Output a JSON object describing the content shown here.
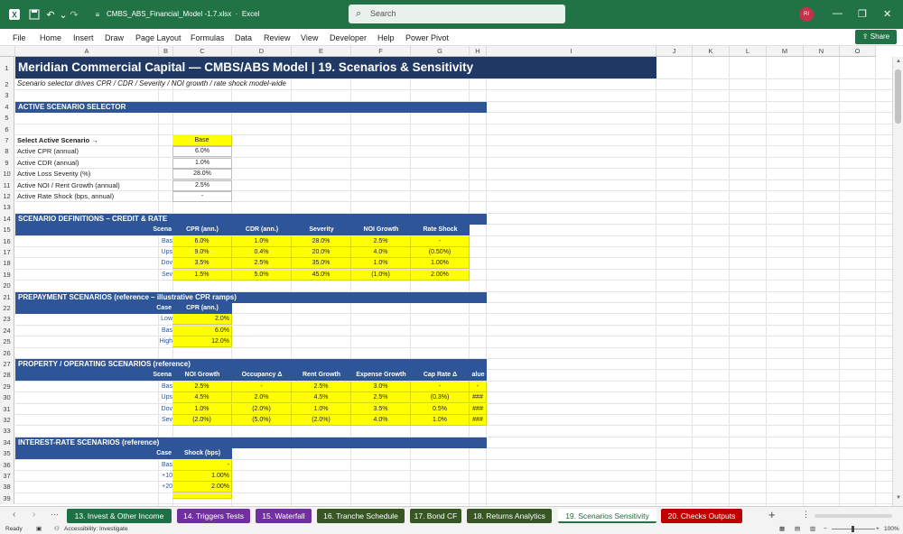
{
  "app": {
    "file_name": "CMBS_ABS_Financial_Model -1.7.xlsx",
    "app_name": "Excel",
    "search_placeholder": "Search",
    "user_initials": "RI",
    "share_label": "Share"
  },
  "menu": [
    "File",
    "Home",
    "Insert",
    "Draw",
    "Page Layout",
    "Formulas",
    "Data",
    "Review",
    "View",
    "Developer",
    "Help",
    "Power Pivot"
  ],
  "columns": [
    "A",
    "B",
    "C",
    "D",
    "E",
    "F",
    "G",
    "H",
    "I",
    "J",
    "K",
    "L",
    "M",
    "N",
    "O"
  ],
  "rows": [
    "1",
    "2",
    "3",
    "4",
    "5",
    "6",
    "7",
    "8",
    "9",
    "10",
    "11",
    "12",
    "13",
    "14",
    "15",
    "16",
    "17",
    "18",
    "19",
    "20",
    "21",
    "22",
    "23",
    "24",
    "25",
    "26",
    "27",
    "28",
    "29",
    "30",
    "31",
    "32",
    "33",
    "34",
    "35",
    "36",
    "37",
    "38",
    "39"
  ],
  "sheet": {
    "title": "Meridian Commercial Capital — CMBS/ABS Model  |  19. Scenarios & Sensitivity",
    "subtitle": "Scenario selector drives CPR / CDR / Severity / NOI growth / rate shock model-wide",
    "selector": {
      "header": "ACTIVE SCENARIO SELECTOR",
      "rows": [
        {
          "label": "Select Active Scenario →",
          "value": "Base",
          "bold": true,
          "yellow": true
        },
        {
          "label": "Active CPR (annual)",
          "value": "6.0%"
        },
        {
          "label": "Active CDR (annual)",
          "value": "1.0%"
        },
        {
          "label": "Active Loss Severity (%)",
          "value": "28.0%"
        },
        {
          "label": "Active NOI / Rent Growth (annual)",
          "value": "2.5%"
        },
        {
          "label": "Active Rate Shock (bps, annual)",
          "value": "-"
        }
      ]
    },
    "definitions": {
      "header": "SCENARIO DEFINITIONS – CREDIT & RATE",
      "col_label": "Scena",
      "columns": [
        "CPR (ann.)",
        "CDR (ann.)",
        "Severity",
        "NOI Growth",
        "Rate Shock"
      ],
      "rows": [
        {
          "label": "Bas",
          "values": [
            "6.0%",
            "1.0%",
            "28.0%",
            "2.5%",
            "-"
          ]
        },
        {
          "label": "Ups",
          "values": [
            "9.0%",
            "0.4%",
            "20.0%",
            "4.0%",
            "(0.50%)"
          ]
        },
        {
          "label": "Dov",
          "values": [
            "3.5%",
            "2.5%",
            "35.0%",
            "1.0%",
            "1.00%"
          ]
        },
        {
          "label": "Sev",
          "values": [
            "1.5%",
            "5.0%",
            "45.0%",
            "(1.0%)",
            "2.00%"
          ]
        }
      ]
    },
    "prepayment": {
      "header": "PREPAYMENT SCENARIOS (reference – illustrative CPR ramps)",
      "col_label": "Case",
      "column": "CPR (ann.)",
      "rows": [
        {
          "label": "Low",
          "value": "2.0%"
        },
        {
          "label": "Bas",
          "value": "6.0%"
        },
        {
          "label": "High",
          "value": "12.0%"
        }
      ]
    },
    "property": {
      "header": "PROPERTY / OPERATING SCENARIOS (reference)",
      "col_label": "Scena",
      "columns": [
        "NOI Growth",
        "Occupancy Δ",
        "Rent Growth",
        "Expense Growth",
        "Cap Rate Δ",
        "alue"
      ],
      "rows": [
        {
          "label": "Bas",
          "values": [
            "2.5%",
            "-",
            "2.5%",
            "3.0%",
            "-",
            "-"
          ]
        },
        {
          "label": "Ups",
          "values": [
            "4.5%",
            "2.0%",
            "4.5%",
            "2.5%",
            "(0.3%)",
            "###"
          ]
        },
        {
          "label": "Dov",
          "values": [
            "1.0%",
            "(2.0%)",
            "1.0%",
            "3.5%",
            "0.5%",
            "###"
          ]
        },
        {
          "label": "Sev",
          "values": [
            "(2.0%)",
            "(5.0%)",
            "(2.0%)",
            "4.0%",
            "1.0%",
            "###"
          ]
        }
      ]
    },
    "interest": {
      "header": "INTEREST-RATE SCENARIOS (reference)",
      "col_label": "Case",
      "column": "Shock (bps)",
      "rows": [
        {
          "label": "Bas",
          "value": "-"
        },
        {
          "label": "+10",
          "value": "1.00%"
        },
        {
          "label": "+20",
          "value": "2.00%"
        }
      ]
    }
  },
  "tabs": [
    {
      "label": "13. Invest & Other Income",
      "color": "#1e7145"
    },
    {
      "label": "14. Triggers Tests",
      "color": "#7030a0"
    },
    {
      "label": "15. Waterfall",
      "color": "#7030a0"
    },
    {
      "label": "16. Tranche Schedule",
      "color": "#375623"
    },
    {
      "label": "17. Bond CF",
      "color": "#375623"
    },
    {
      "label": "18. Returns Analytics",
      "color": "#375623"
    },
    {
      "label": "19. Scenarios Sensitivity",
      "color": "#ffffff",
      "active": true
    },
    {
      "label": "20. Checks Outputs",
      "color": "#c00000"
    }
  ],
  "status": {
    "ready": "Ready",
    "accessibility": "Accessibility: Investigate",
    "zoom": "100%"
  }
}
